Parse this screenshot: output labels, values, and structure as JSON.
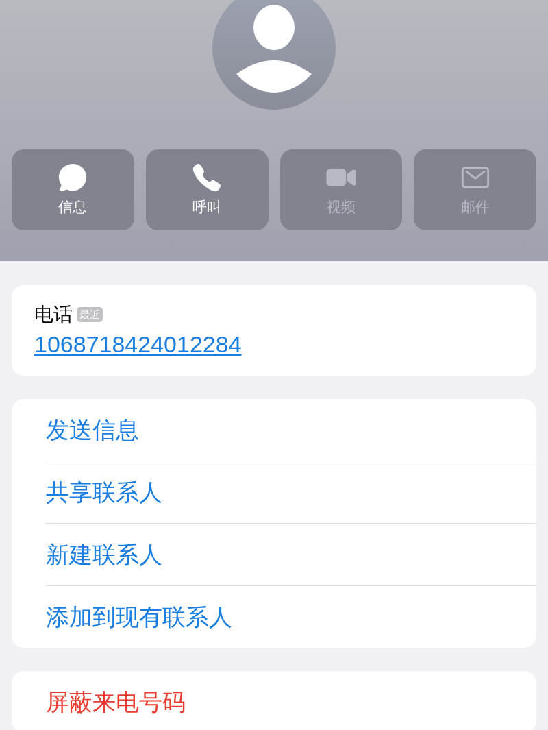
{
  "actions": [
    {
      "kind": "message",
      "label": "信息",
      "disabled": false
    },
    {
      "kind": "call",
      "label": "呼叫",
      "disabled": false
    },
    {
      "kind": "video",
      "label": "视频",
      "disabled": true
    },
    {
      "kind": "mail",
      "label": "邮件",
      "disabled": true
    }
  ],
  "phone": {
    "label": "电话",
    "badge": "最近",
    "number": "1068718424012284"
  },
  "options": [
    {
      "label": "发送信息",
      "destructive": false
    },
    {
      "label": "共享联系人",
      "destructive": false
    },
    {
      "label": "新建联系人",
      "destructive": false
    },
    {
      "label": "添加到现有联系人",
      "destructive": false
    }
  ],
  "danger_options": [
    {
      "label": "屏蔽来电号码",
      "destructive": true
    }
  ]
}
